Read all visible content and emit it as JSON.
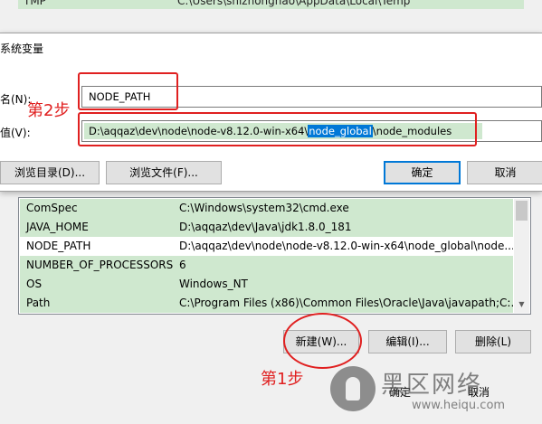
{
  "background_top": {
    "row_name": "TMP",
    "row_value": "C:\\Users\\shizhonghao\\AppData\\Local\\Temp"
  },
  "edit_dialog": {
    "title": "系统变量",
    "name_label": "名(N):",
    "value_label": "值(V):",
    "name_value": "NODE_PATH",
    "value_prefix": "D:\\aqqaz\\dev\\node\\node-v8.12.0-win-x64\\",
    "value_selected": "node_global",
    "value_suffix": "\\node_modules",
    "buttons": {
      "browse_dir": "浏览目录(D)...",
      "browse_file": "浏览文件(F)...",
      "ok": "确定",
      "cancel": "取消"
    }
  },
  "system_variables": {
    "rows": [
      {
        "name": "ComSpec",
        "value": "C:\\Windows\\system32\\cmd.exe"
      },
      {
        "name": "JAVA_HOME",
        "value": "D:\\aqqaz\\dev\\Java\\jdk1.8.0_181"
      },
      {
        "name": "NODE_PATH",
        "value": "D:\\aqqaz\\dev\\node\\node-v8.12.0-win-x64\\node_global\\node..."
      },
      {
        "name": "NUMBER_OF_PROCESSORS",
        "value": "6"
      },
      {
        "name": "OS",
        "value": "Windows_NT"
      },
      {
        "name": "Path",
        "value": "C:\\Program Files (x86)\\Common Files\\Oracle\\Java\\javapath;C:..."
      }
    ],
    "buttons": {
      "new": "新建(W)...",
      "edit": "编辑(I)...",
      "delete": "删除(L)"
    }
  },
  "footer_buttons": {
    "ok": "确定",
    "cancel": "取消"
  },
  "annotations": {
    "step1": "第1步",
    "step2": "第2步",
    "color": "#e02020"
  },
  "watermark": {
    "title": "黑区网络",
    "url": "www.heiqu.com"
  },
  "colors": {
    "selection": "#0078d7",
    "row_highlight": "#cfe8cf"
  }
}
